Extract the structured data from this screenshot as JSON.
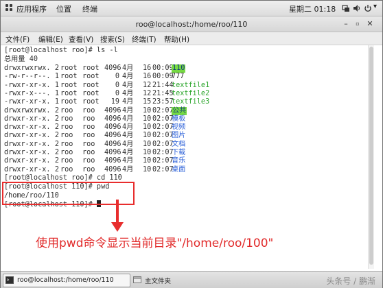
{
  "topbar": {
    "apps_label": "应用程序",
    "places_label": "位置",
    "terminal_label": "终端",
    "datetime": "星期二 01:18"
  },
  "window": {
    "title": "roo@localhost:/home/roo/110"
  },
  "menubar": {
    "items": [
      "文件(F)",
      "编辑(E)",
      "查看(V)",
      "搜索(S)",
      "终端(T)",
      "帮助(H)"
    ]
  },
  "terminal": {
    "prompt_ls": "[root@localhost roo]# ls -l",
    "total": "总用量 40",
    "entries": [
      {
        "perm": "drwxrwxrwx.",
        "links": "2",
        "owner": "root",
        "group": "root",
        "size": "4096",
        "month": "4月",
        "day": "16",
        "time": "00:09",
        "name": "110",
        "color": "highlight"
      },
      {
        "perm": "-rw-r--r--.",
        "links": "1",
        "owner": "root",
        "group": "root",
        "size": "0",
        "month": "4月",
        "day": "16",
        "time": "00:09",
        "name": "777",
        "color": "plain"
      },
      {
        "perm": "-rwxr-xr-x.",
        "links": "1",
        "owner": "root",
        "group": "root",
        "size": "0",
        "month": "4月",
        "day": "12",
        "time": "21:44",
        "name": "textfile1",
        "color": "green"
      },
      {
        "perm": "-rwxr-x---.",
        "links": "1",
        "owner": "root",
        "group": "root",
        "size": "0",
        "month": "4月",
        "day": "12",
        "time": "21:45",
        "name": "textfile2",
        "color": "green"
      },
      {
        "perm": "-rwxr-xr-x.",
        "links": "1",
        "owner": "root",
        "group": "root",
        "size": "19",
        "month": "4月",
        "day": "15",
        "time": "23:57",
        "name": "textfile3",
        "color": "green"
      },
      {
        "perm": "drwxrwxrwx.",
        "links": "2",
        "owner": "roo",
        "group": "roo",
        "size": "4096",
        "month": "4月",
        "day": "10",
        "time": "02:07",
        "name": "公共",
        "color": "highlight"
      },
      {
        "perm": "drwxr-xr-x.",
        "links": "2",
        "owner": "roo",
        "group": "roo",
        "size": "4096",
        "month": "4月",
        "day": "10",
        "time": "02:07",
        "name": "模板",
        "color": "blue"
      },
      {
        "perm": "drwxr-xr-x.",
        "links": "2",
        "owner": "roo",
        "group": "roo",
        "size": "4096",
        "month": "4月",
        "day": "10",
        "time": "02:07",
        "name": "视频",
        "color": "blue"
      },
      {
        "perm": "drwxr-xr-x.",
        "links": "2",
        "owner": "roo",
        "group": "roo",
        "size": "4096",
        "month": "4月",
        "day": "10",
        "time": "02:07",
        "name": "图片",
        "color": "blue"
      },
      {
        "perm": "drwxr-xr-x.",
        "links": "2",
        "owner": "roo",
        "group": "roo",
        "size": "4096",
        "month": "4月",
        "day": "10",
        "time": "02:07",
        "name": "文档",
        "color": "blue"
      },
      {
        "perm": "drwxr-xr-x.",
        "links": "2",
        "owner": "roo",
        "group": "roo",
        "size": "4096",
        "month": "4月",
        "day": "10",
        "time": "02:07",
        "name": "下载",
        "color": "blue"
      },
      {
        "perm": "drwxr-xr-x.",
        "links": "2",
        "owner": "roo",
        "group": "roo",
        "size": "4096",
        "month": "4月",
        "day": "10",
        "time": "02:07",
        "name": "音乐",
        "color": "blue"
      },
      {
        "perm": "drwxr-xr-x.",
        "links": "2",
        "owner": "roo",
        "group": "roo",
        "size": "4096",
        "month": "4月",
        "day": "10",
        "time": "02:07",
        "name": "桌面",
        "color": "blue"
      }
    ],
    "prompt_cd": "[root@localhost roo]# cd 110",
    "prompt_pwd": "[root@localhost 110]# pwd",
    "pwd_output": "/home/roo/110",
    "prompt_last": "[root@localhost 110]# "
  },
  "annotation": {
    "caption": "使用pwd命令显示当前目录\"/home/roo/100\"",
    "color": "#e12a2a"
  },
  "taskbar": {
    "terminal_task": "roo@localhost:/home/roo/110",
    "files_task": "主文件夹",
    "watermark": "头条号 / 鹏渐"
  },
  "colors": {
    "dir_highlight_bg": "#76d943",
    "exec_green": "#28a428",
    "dir_blue": "#2a5fd8"
  }
}
